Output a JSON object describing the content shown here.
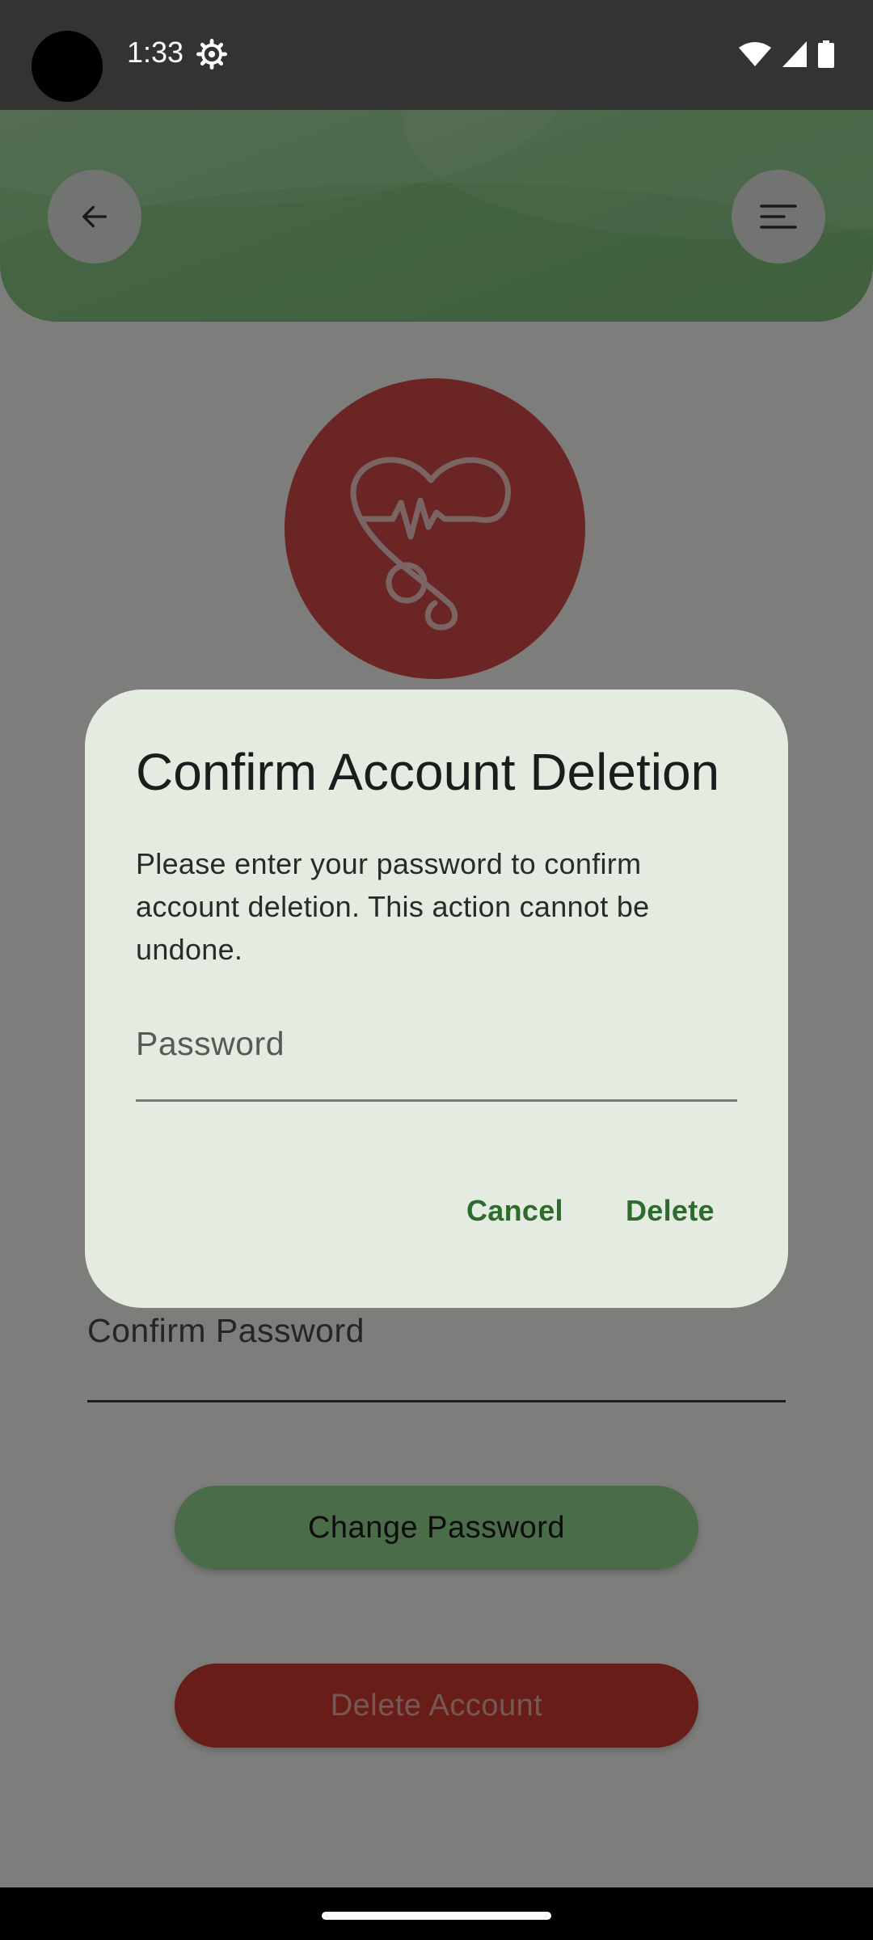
{
  "status_bar": {
    "time": "1:33",
    "icons": [
      "settings-gear-icon",
      "wifi-icon",
      "signal-icon",
      "battery-icon"
    ]
  },
  "header": {
    "back_icon": "arrow-left-icon",
    "menu_icon": "menu-lines-icon",
    "color": "#8fcf8b"
  },
  "avatar": {
    "icon": "heart-stethoscope-icon",
    "color": "#d94a4a"
  },
  "form": {
    "confirm_password_label": "Confirm Password"
  },
  "buttons": {
    "change_password": "Change Password",
    "delete_account": "Delete Account"
  },
  "dialog": {
    "title": "Confirm Account Deletion",
    "message": "Please enter your password to confirm account deletion. This action cannot be undone.",
    "password_placeholder": "Password",
    "password_value": "",
    "cancel_label": "Cancel",
    "delete_label": "Delete",
    "accent_color": "#2e6b2c"
  }
}
